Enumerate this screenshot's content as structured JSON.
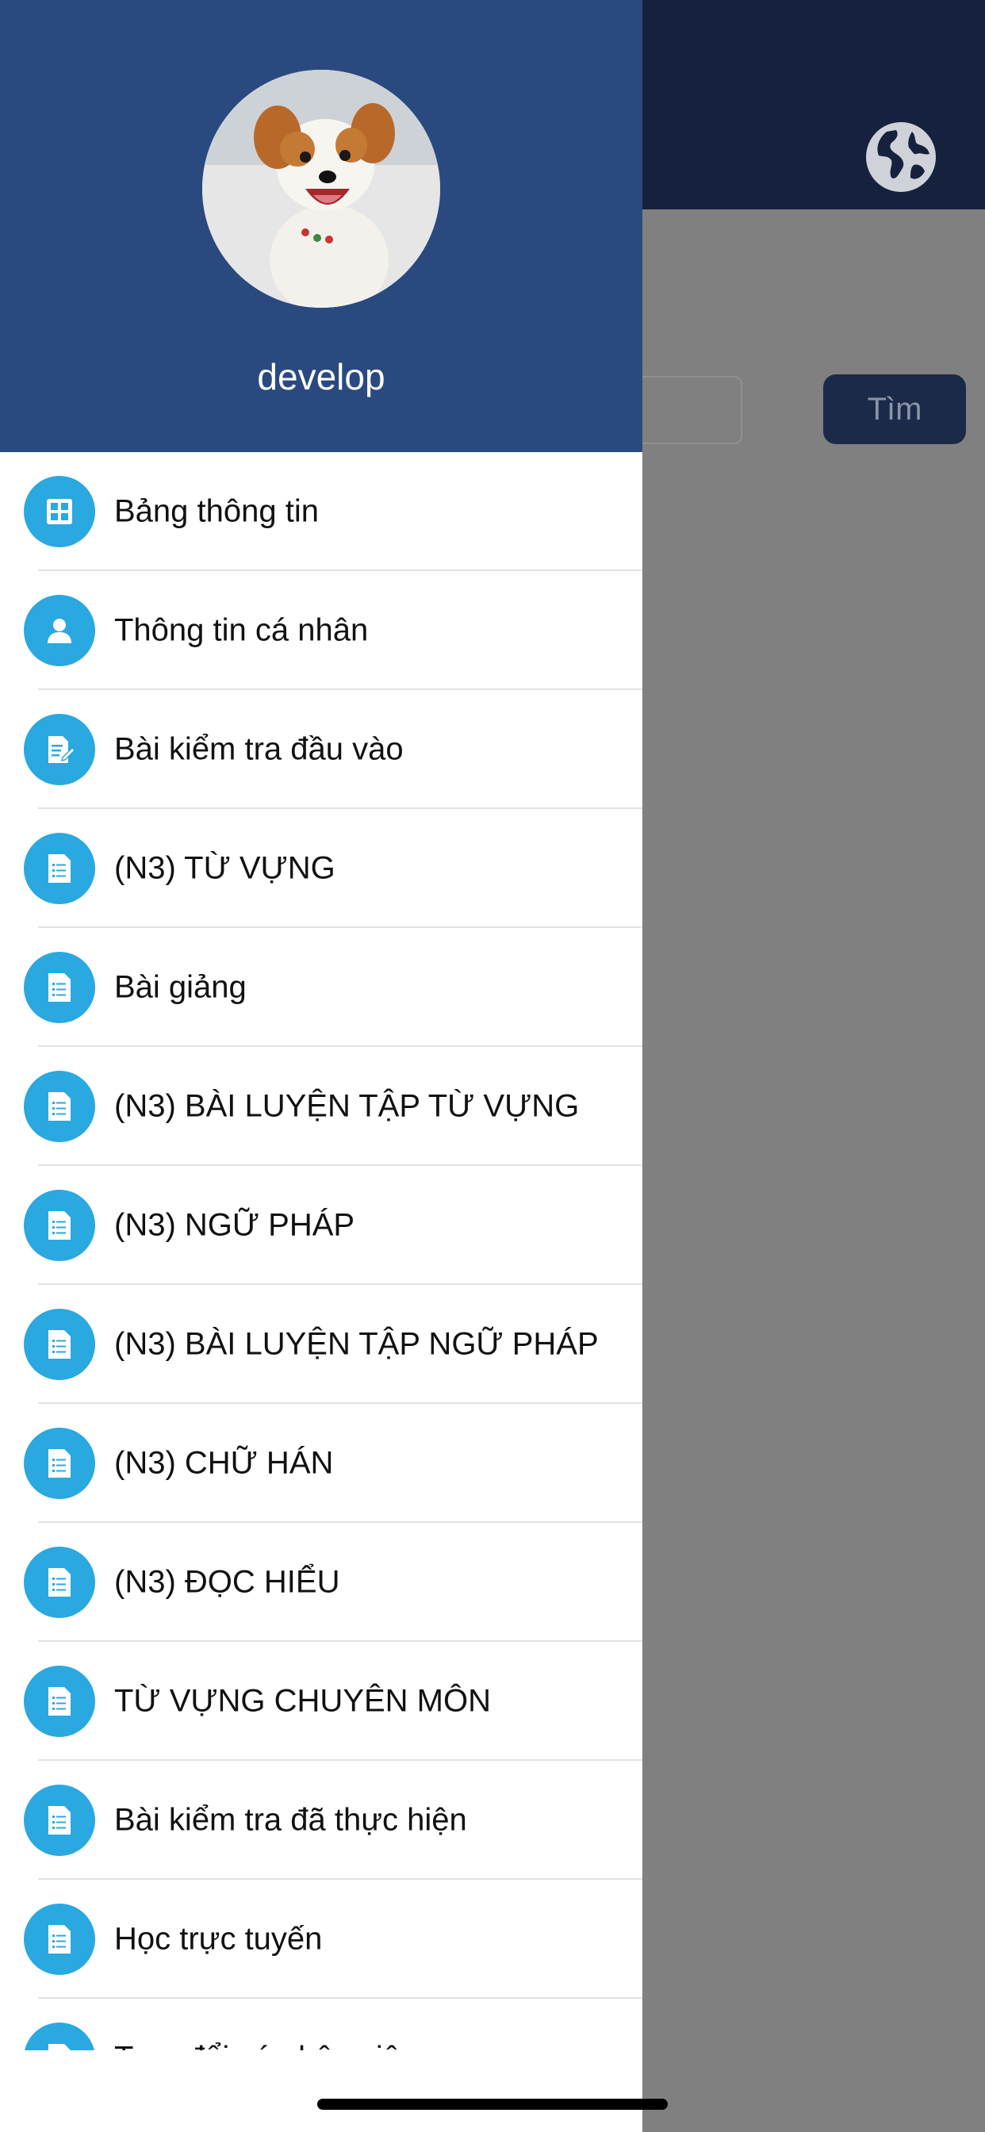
{
  "background": {
    "search_button_label": "Tìm",
    "globe_icon": "globe-icon"
  },
  "drawer": {
    "username": "develop",
    "menu_items": [
      {
        "label": "Bảng thông tin",
        "icon": "dashboard-icon"
      },
      {
        "label": "Thông tin cá nhân",
        "icon": "user-icon"
      },
      {
        "label": "Bài kiểm tra đầu vào",
        "icon": "edit-document-icon"
      },
      {
        "label": "(N3) TỪ VỰNG",
        "icon": "document-icon"
      },
      {
        "label": "Bài giảng",
        "icon": "document-icon"
      },
      {
        "label": "(N3) BÀI LUYỆN TẬP TỪ VỰNG",
        "icon": "document-icon"
      },
      {
        "label": "(N3) NGỮ PHÁP",
        "icon": "document-icon"
      },
      {
        "label": "(N3) BÀI LUYỆN TẬP NGỮ PHÁP",
        "icon": "document-icon"
      },
      {
        "label": "(N3) CHỮ HÁN",
        "icon": "document-icon"
      },
      {
        "label": "(N3) ĐỌC HIỂU",
        "icon": "document-icon"
      },
      {
        "label": "TỪ VỰNG CHUYÊN MÔN",
        "icon": "document-icon"
      },
      {
        "label": "Bài kiểm tra đã thực hiện",
        "icon": "document-icon"
      },
      {
        "label": "Học trực tuyến",
        "icon": "document-icon"
      },
      {
        "label": "Trao đổi cá nhân việc",
        "icon": "document-icon"
      }
    ]
  },
  "colors": {
    "header": "#2a4a7f",
    "icon_circle": "#2aa8e0",
    "top_bar": "#16213e"
  }
}
